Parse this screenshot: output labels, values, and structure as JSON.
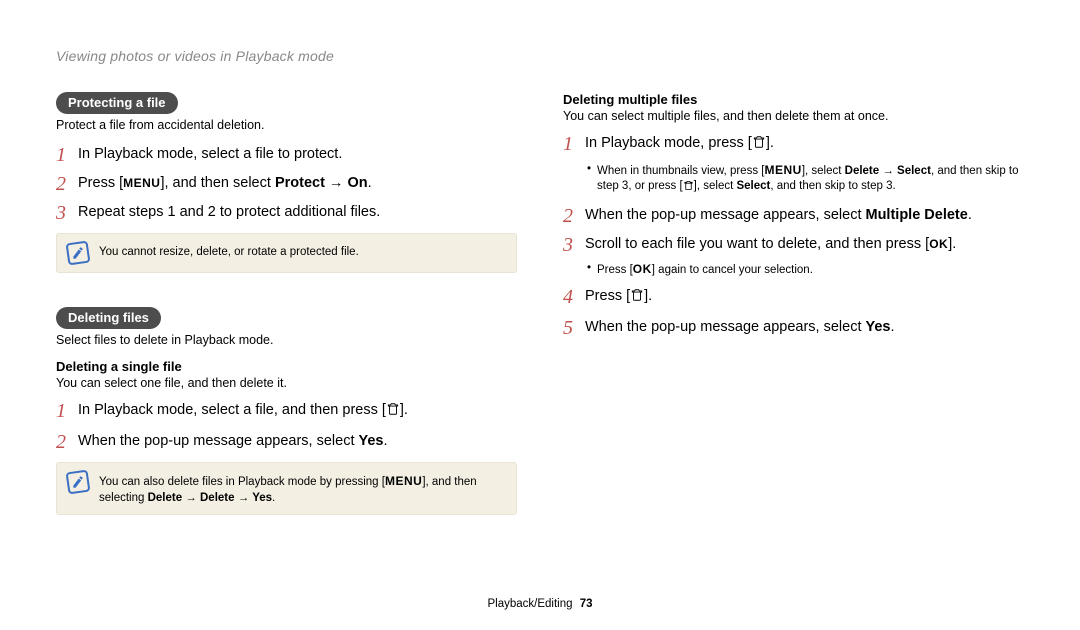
{
  "running_head": "Viewing photos or videos in Playback mode",
  "icons": {
    "menu_text": "MENU",
    "ok_text": "OK"
  },
  "left": {
    "protecting": {
      "pill": "Protecting a file",
      "intro": "Protect a file from accidental deletion.",
      "step1": "In Playback mode, select a file to protect.",
      "step2_a": "Press [",
      "step2_b": "], and then select ",
      "step2_bold": "Protect → On",
      "step3": "Repeat steps 1 and 2 to protect additional files.",
      "note": "You cannot resize, delete, or rotate a protected file."
    },
    "deleting": {
      "pill": "Deleting files",
      "intro": "Select files to delete in Playback mode.",
      "single_head": "Deleting a single file",
      "single_intro": "You can select one file, and then delete it.",
      "step1_a": "In Playback mode, select a file, and then press [",
      "step1_b": "].",
      "step2_a": "When the pop-up message appears, select ",
      "step2_bold": "Yes",
      "note_a": "You can also delete files in Playback mode by pressing [",
      "note_b": "], and then selecting ",
      "note_bold": "Delete → Delete → Yes"
    }
  },
  "right": {
    "multi_head": "Deleting multiple files",
    "multi_intro": "You can select multiple files, and then delete them at once.",
    "step1_a": "In Playback mode, press [",
    "step1_b": "].",
    "sub1_a": "When in thumbnails view, press [",
    "sub1_b": "], select ",
    "sub1_bold1": "Delete → Select",
    "sub1_c": ", and then skip to step 3, or press [",
    "sub1_d": "], select ",
    "sub1_bold2": "Select",
    "sub1_e": ", and then skip to step 3.",
    "step2_a": "When the pop-up message appears, select ",
    "step2_bold": "Multiple Delete",
    "step3_a": "Scroll to each file you want to delete, and then press [",
    "step3_b": "].",
    "sub3_a": "Press [",
    "sub3_b": "] again to cancel your selection.",
    "step4_a": "Press [",
    "step4_b": "].",
    "step5_a": "When the pop-up message appears, select ",
    "step5_bold": "Yes"
  },
  "footer": {
    "section": "Playback/Editing",
    "page": "73"
  }
}
